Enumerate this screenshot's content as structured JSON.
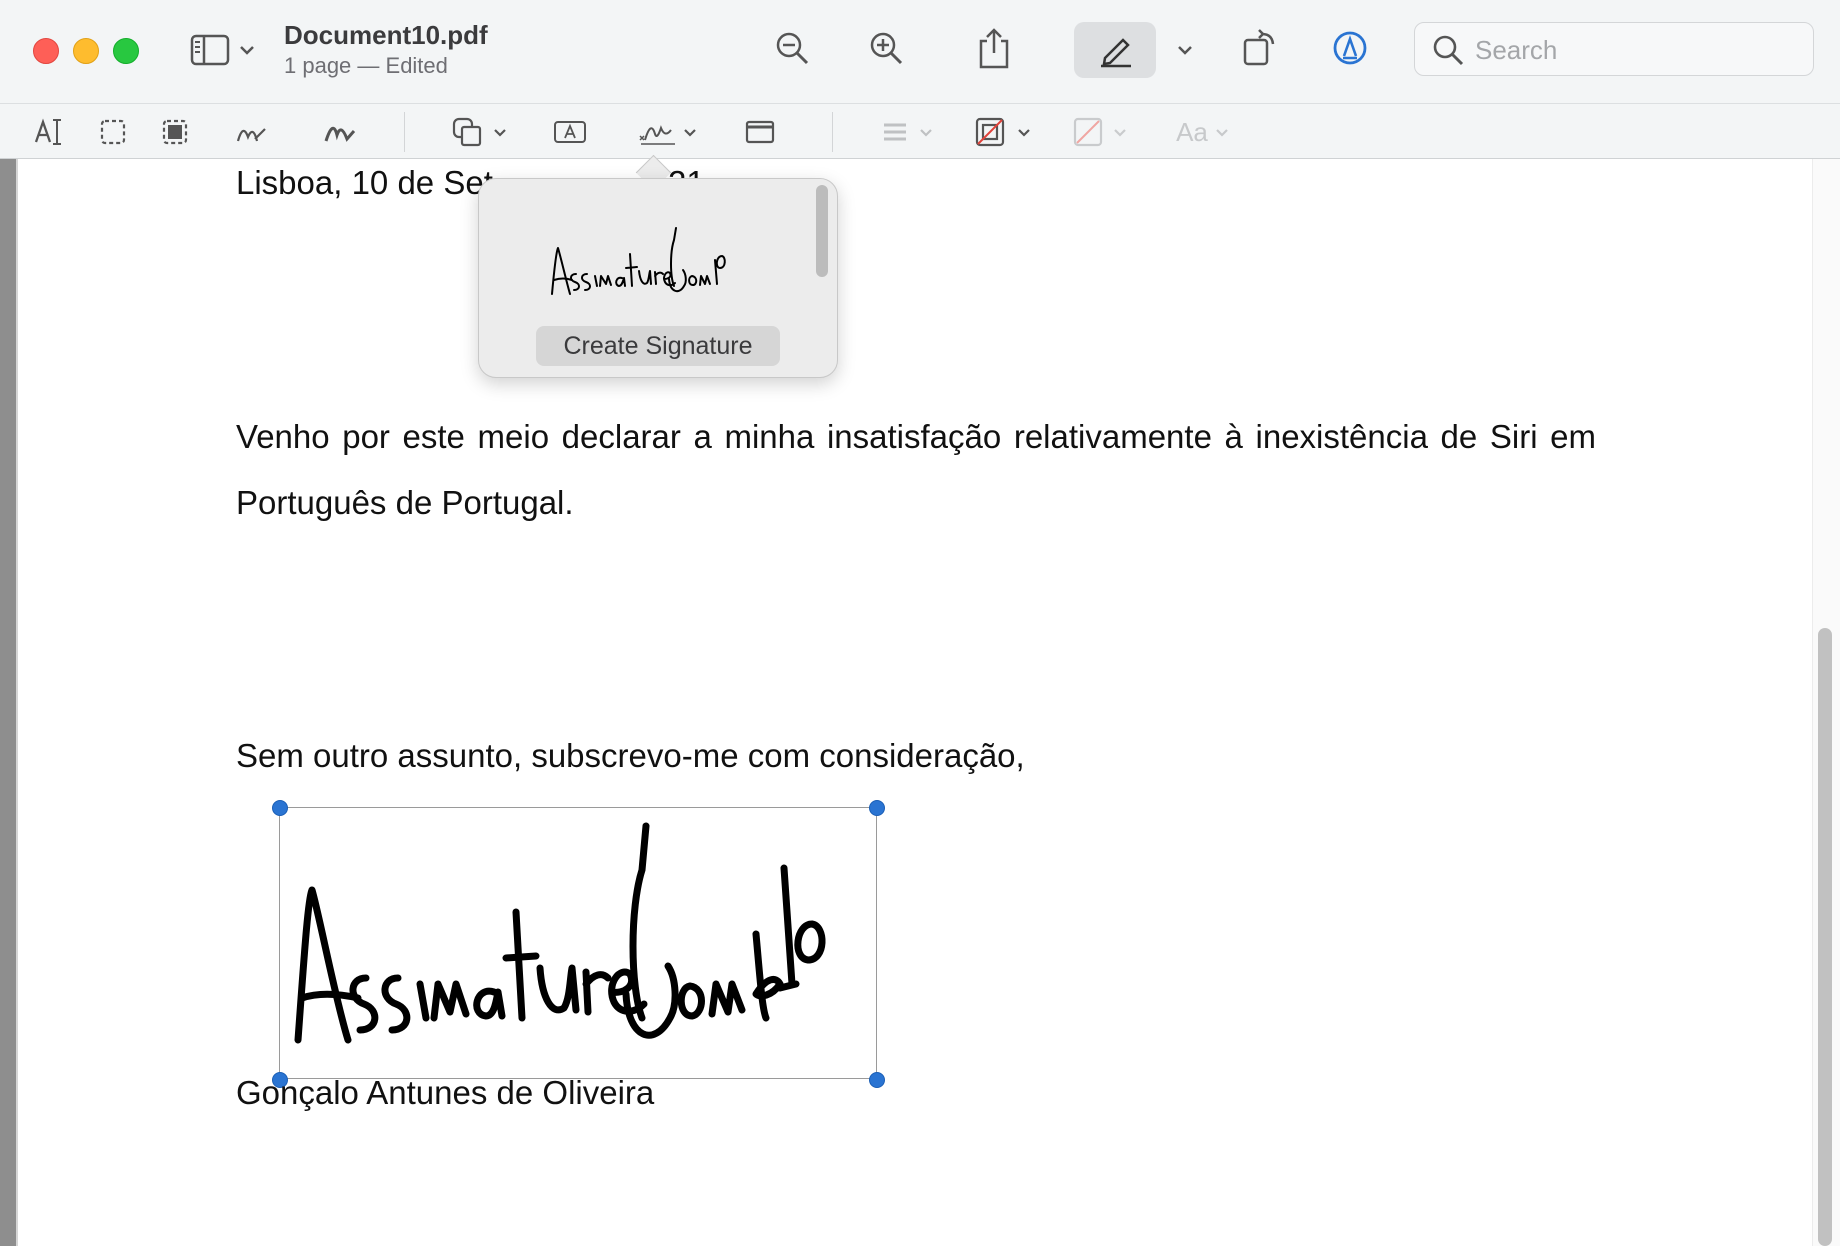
{
  "window": {
    "title": "Document10.pdf",
    "subtitle": "1 page — Edited"
  },
  "search": {
    "placeholder": "Search"
  },
  "toolbar_icons": [
    "sidebar-icon",
    "chevron-down-icon",
    "zoom-out-icon",
    "zoom-in-icon",
    "share-icon",
    "markup-pen-icon",
    "rotate-icon",
    "annotate-icon",
    "search-icon"
  ],
  "markup_tools": [
    "text-selection-icon",
    "rectangular-selection-icon",
    "instant-alpha-icon",
    "sketch-icon",
    "draw-icon",
    "shapes-icon",
    "text-box-icon",
    "signature-icon",
    "note-icon",
    "shape-style-icon",
    "border-color-icon",
    "fill-color-icon",
    "text-style-icon"
  ],
  "markup_text_style_label": "Aa",
  "signature_popover": {
    "signature_thumbnail": "AssinaturaGonçalo",
    "create_label": "Create Signature"
  },
  "document": {
    "date_line_left": "Lisboa, 10 de Set",
    "date_line_right": "21",
    "paragraph_line1": "Venho por este meio declarar a minha insatisfação relativamente à inexistência de Siri em",
    "paragraph_line2": "Português de Portugal.",
    "closing": "Sem outro assunto, subscrevo-me com consideração,",
    "signature_name": "Gonçalo Antunes de Oliveira",
    "signature_image": "AssinaturaGonçalo"
  },
  "colors": {
    "accent": "#2a74d2",
    "close": "#fe5f57",
    "minimize": "#febc2e",
    "zoom": "#28c840"
  }
}
